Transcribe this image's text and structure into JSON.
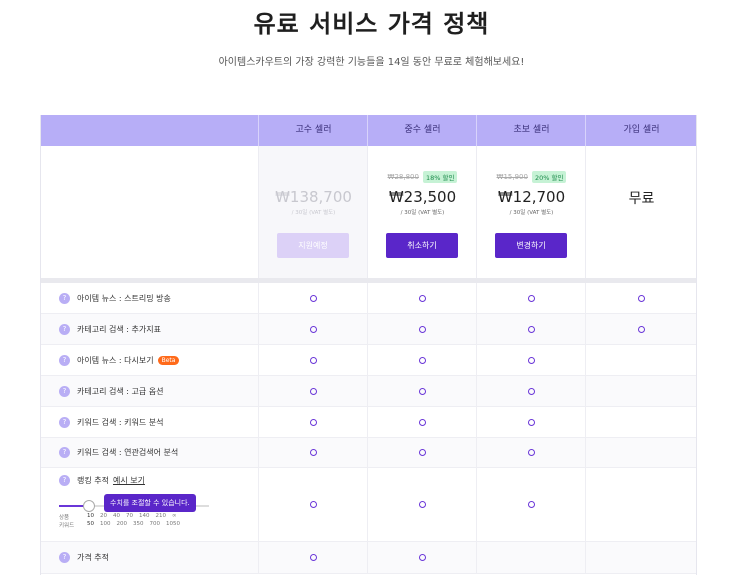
{
  "page": {
    "title": "유료 서비스 가격 정책",
    "subtitle": "아이템스카우트의 가장 강력한 기능들을 14일 동안 무료로 체험해보세요!"
  },
  "plans": [
    {
      "name": "고수 셀러",
      "original_price": "",
      "discount": "",
      "price": "₩138,700",
      "period": "/ 30일 (VAT 별도)",
      "button": "지원예정",
      "disabled": true
    },
    {
      "name": "중수 셀러",
      "original_price": "₩28,800",
      "discount": "18% 할인",
      "price": "₩23,500",
      "period": "/ 30일 (VAT 별도)",
      "button": "취소하기",
      "disabled": false
    },
    {
      "name": "초보 셀러",
      "original_price": "₩15,900",
      "discount": "20% 할인",
      "price": "₩12,700",
      "period": "/ 30일 (VAT 별도)",
      "button": "변경하기",
      "disabled": false
    },
    {
      "name": "가입 셀러",
      "original_price": "",
      "discount": "",
      "price": "무료",
      "period": "",
      "button": "",
      "disabled": false
    }
  ],
  "features": [
    {
      "label": "아이템 뉴스 : 스트리밍 방송",
      "beta": "",
      "marks": [
        "o",
        "o",
        "o",
        "o"
      ]
    },
    {
      "label": "카테고리 검색 : 추가지표",
      "beta": "",
      "marks": [
        "o",
        "o",
        "o",
        "o"
      ]
    },
    {
      "label": "아이템 뉴스 : 다시보기",
      "beta": "Beta",
      "marks": [
        "o",
        "o",
        "o",
        ""
      ]
    },
    {
      "label": "카테고리 검색 : 고급 옵션",
      "beta": "",
      "marks": [
        "o",
        "o",
        "o",
        ""
      ]
    },
    {
      "label": "키워드 검색 : 키워드 분석",
      "beta": "",
      "marks": [
        "o",
        "o",
        "o",
        ""
      ]
    },
    {
      "label": "키워드 검색 : 연관검색어 분석",
      "beta": "",
      "marks": [
        "o",
        "o",
        "o",
        ""
      ]
    },
    {
      "label": "랭킹 추적",
      "beta": "",
      "marks": [
        "o",
        "o",
        "o",
        ""
      ]
    },
    {
      "label": "가격 추적",
      "beta": "",
      "marks": [
        "o",
        "o",
        "",
        ""
      ]
    }
  ],
  "ranking": {
    "link": "예시 보기",
    "tooltip": "수치를 조절할 수 있습니다.",
    "row1_label": "상품",
    "row1_values": [
      "10",
      "20",
      "40",
      "70",
      "140",
      "210",
      "∞"
    ],
    "row2_label": "키워드",
    "row2_values": [
      "50",
      "100",
      "200",
      "350",
      "700",
      "1050"
    ],
    "selected_value": 0.19
  },
  "info_icon": "?",
  "colors": {
    "header": "#b7aef7",
    "accent": "#5a26c9",
    "mark": "#6a36d8",
    "beta": "#ff6a1a"
  }
}
